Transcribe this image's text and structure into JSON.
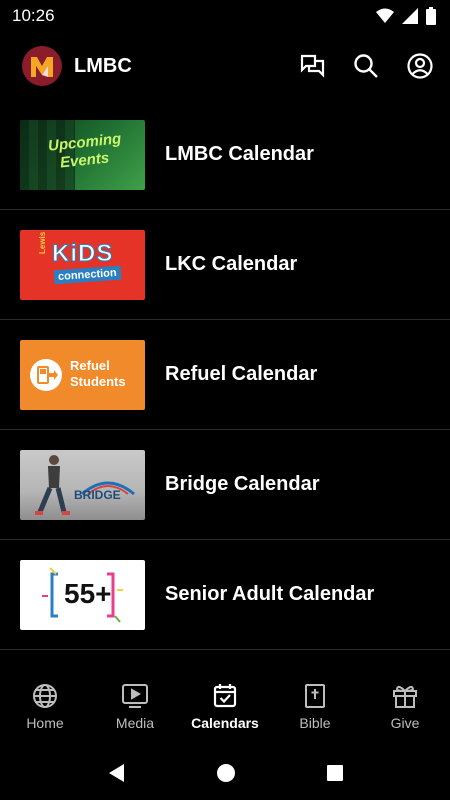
{
  "status": {
    "time": "10:26"
  },
  "app": {
    "title": "LMBC"
  },
  "items": [
    {
      "label": "LMBC Calendar",
      "thumb_line1": "Upcoming",
      "thumb_line2": "Events"
    },
    {
      "label": "LKC Calendar",
      "thumb_small": "Lewis",
      "thumb_big": "KiDS",
      "thumb_sub": "connection"
    },
    {
      "label": "Refuel Calendar",
      "thumb_line1": "Refuel",
      "thumb_line2": "Students"
    },
    {
      "label": "Bridge Calendar",
      "thumb_text": "BRIDGE"
    },
    {
      "label": "Senior Adult Calendar",
      "thumb_text": "55+"
    }
  ],
  "nav": [
    {
      "label": "Home",
      "icon": "globe-icon"
    },
    {
      "label": "Media",
      "icon": "play-icon"
    },
    {
      "label": "Calendars",
      "icon": "calendar-icon",
      "active": true
    },
    {
      "label": "Bible",
      "icon": "bible-icon"
    },
    {
      "label": "Give",
      "icon": "gift-icon"
    }
  ],
  "colors": {
    "background": "#000000",
    "logo_bg": "#8a1c2b",
    "lkc_red": "#e53328",
    "refuel_orange": "#f08a2a"
  }
}
